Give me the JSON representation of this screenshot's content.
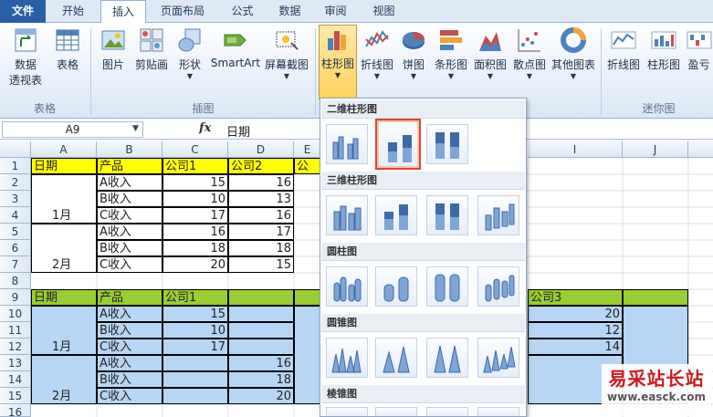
{
  "tabs": [
    {
      "label": "文件"
    },
    {
      "label": "开始"
    },
    {
      "label": "插入"
    },
    {
      "label": "页面布局"
    },
    {
      "label": "公式"
    },
    {
      "label": "数据"
    },
    {
      "label": "审阅"
    },
    {
      "label": "视图"
    }
  ],
  "ribbon": {
    "pivot_label_1": "数据",
    "pivot_label_2": "透视表",
    "table_label": "表格",
    "picture_label": "图片",
    "clipart_label": "剪贴画",
    "shapes_label": "形状",
    "smartart_label": "SmartArt",
    "screenshot_label": "屏幕截图",
    "column_label": "柱形图",
    "line_label": "折线图",
    "pie_label": "饼图",
    "bar_label": "条形图",
    "area_label": "面积图",
    "scatter_label": "散点图",
    "other_label": "其他图表",
    "spark_line_label": "折线图",
    "spark_column_label": "柱形图",
    "spark_winloss_label": "盈亏",
    "group_tables": "表格",
    "group_illustrations": "插图",
    "group_sparklines": "迷你图"
  },
  "formula_bar": {
    "name_box": "A9",
    "fx": "fx",
    "content": "日期"
  },
  "columns": [
    "A",
    "B",
    "C",
    "D",
    "E",
    "I",
    "J"
  ],
  "rows": [
    "1",
    "2",
    "3",
    "4",
    "5",
    "6",
    "7",
    "8",
    "9",
    "10",
    "11",
    "12",
    "13",
    "14",
    "15",
    "16"
  ],
  "table1": {
    "headers": [
      "日期",
      "产品",
      "公司1",
      "公司2",
      "公"
    ],
    "month1": "1月",
    "month2": "2月",
    "products": [
      "A收入",
      "B收入",
      "C收入",
      "A收入",
      "B收入",
      "C收入"
    ],
    "company1": [
      "15",
      "10",
      "17",
      "16",
      "18",
      "20"
    ],
    "company2": [
      "16",
      "13",
      "16",
      "17",
      "18",
      "15"
    ]
  },
  "table2": {
    "headers": [
      "日期",
      "产品",
      "公司1"
    ],
    "company3_header": "公司3",
    "month1": "1月",
    "month2": "2月",
    "products": [
      "A收入",
      "B收入",
      "C收入",
      "A收入",
      "B收入",
      "C收入"
    ],
    "company1": [
      "15",
      "10",
      "17"
    ],
    "company2": [
      "16",
      "18",
      "20"
    ],
    "company3": [
      "20",
      "12",
      "14"
    ]
  },
  "dropdown": {
    "section_2d": "二维柱形图",
    "section_3d": "三维柱形图",
    "section_cylinder": "圆柱图",
    "section_cone": "圆锥图",
    "section_pyramid": "棱锥图"
  },
  "watermark": {
    "line1": "易采站长站",
    "line2": "www.easck.com"
  },
  "colors": {
    "file_tab": "#2a5fa8",
    "header_yellow": "#ffff00",
    "header_green": "#9acd32",
    "selection_blue": "#b7d6f5",
    "highlight_red": "#e0433d"
  }
}
